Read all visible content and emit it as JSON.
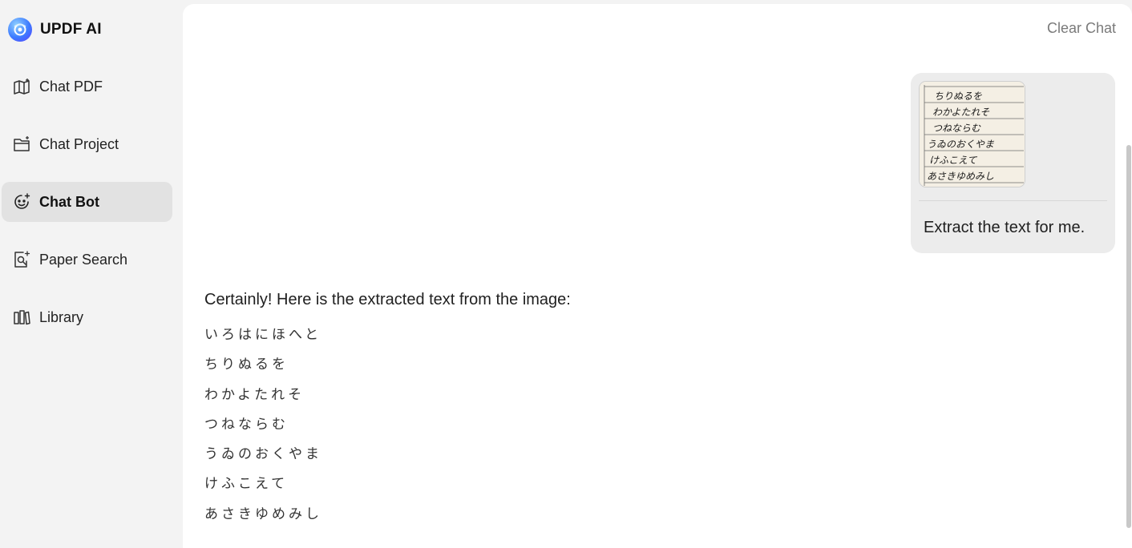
{
  "brand": {
    "name": "UPDF AI"
  },
  "sidebar": {
    "items": [
      {
        "label": "Chat PDF",
        "icon": "chat-pdf-icon"
      },
      {
        "label": "Chat Project",
        "icon": "chat-project-icon"
      },
      {
        "label": "Chat Bot",
        "icon": "chat-bot-icon",
        "active": true
      },
      {
        "label": "Paper Search",
        "icon": "paper-search-icon"
      },
      {
        "label": "Library",
        "icon": "library-icon"
      }
    ]
  },
  "header": {
    "clear_chat_label": "Clear Chat"
  },
  "conversation": {
    "user_message": {
      "image_lines": [
        "ちりぬるを",
        "わかよたれそ",
        "つねならむ",
        "うゐのおくやま",
        "けふこえて",
        "あさきゆめみし"
      ],
      "text": "Extract the text for me."
    },
    "assistant_message": {
      "intro": "Certainly! Here is the extracted text from the image:",
      "lines": [
        "いろはにほへと",
        "ちりぬるを",
        "わかよたれそ",
        "つねならむ",
        "うゐのおくやま",
        "けふこえて",
        "あさきゆめみし"
      ]
    }
  },
  "colors": {
    "sidebar_bg": "#f3f3f3",
    "active_item_bg": "#e2e2e2",
    "bubble_bg": "#ececec",
    "muted_text": "#7a7a7a"
  }
}
